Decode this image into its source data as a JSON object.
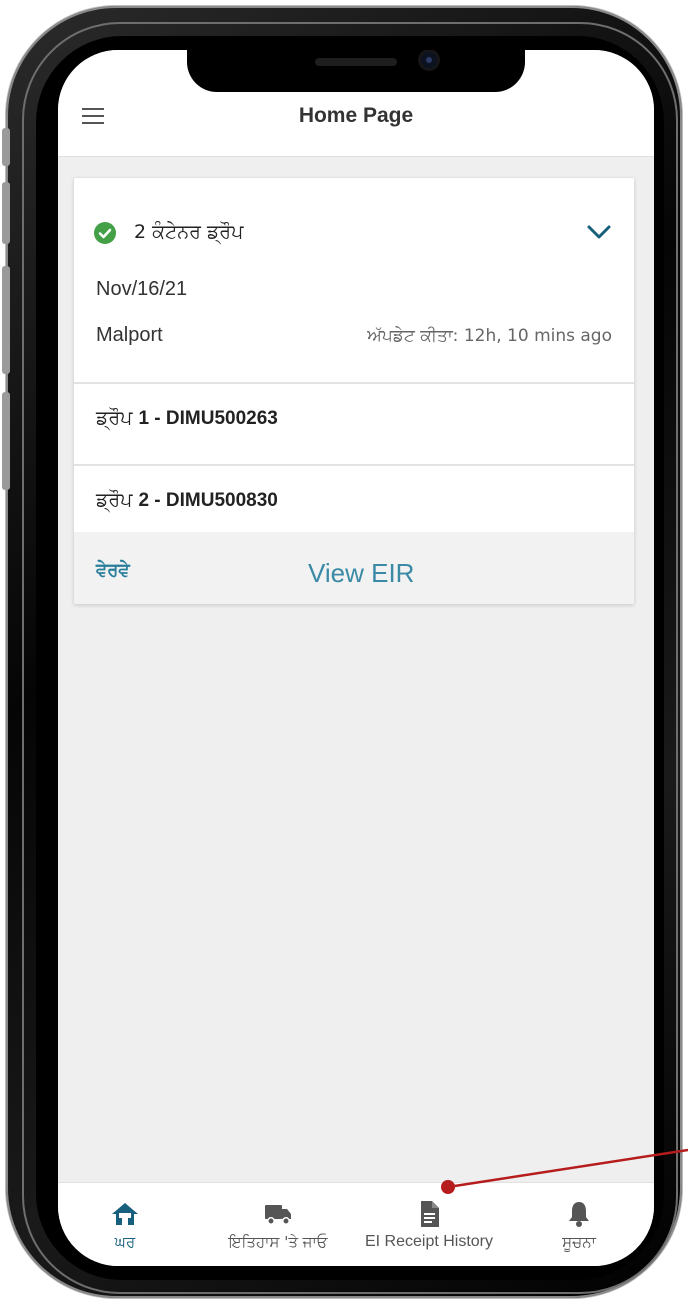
{
  "header": {
    "title": "Home Page"
  },
  "card": {
    "title": "2 ਕੰਟੇਨਰ ਡ੍ਰੌਪ",
    "date": "Nov/16/21",
    "location": "Malport",
    "updated": "ਅੱਪਡੇਟ ਕੀਤਾ: 12h, 10 mins ago",
    "drops": [
      {
        "prefix": "ਡ੍ਰੌਪ ",
        "label": "1 - DIMU500263"
      },
      {
        "prefix": "ਡ੍ਰੌਪ ",
        "label": "2 - DIMU500830"
      }
    ],
    "details_label": "ਵੇਰਵੇ",
    "view_eir_label": "View EIR"
  },
  "bottom_nav": [
    {
      "label": "ਘਰ",
      "icon": "home-icon",
      "active": true
    },
    {
      "label": "ਇਤਿਹਾਸ 'ਤੇ ਜਾਓ",
      "icon": "truck-icon",
      "active": false
    },
    {
      "label": "EI Receipt History",
      "icon": "document-icon",
      "active": false
    },
    {
      "label": "ਸੂਚਨਾ",
      "icon": "bell-icon",
      "active": false
    }
  ],
  "colors": {
    "accent": "#17607d",
    "link": "#3a8aa6",
    "success": "#43a047",
    "annotation": "#b71c1c",
    "background": "#efefef"
  }
}
